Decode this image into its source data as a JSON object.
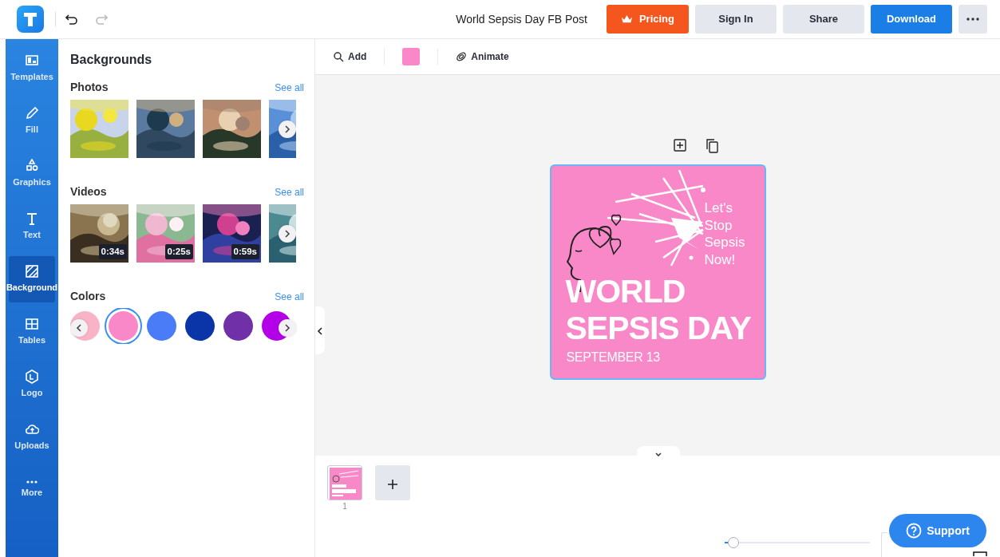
{
  "header": {
    "title": "World Sepsis Day FB Post",
    "buttons": [
      {
        "label": "Pricing",
        "kind": "pricing"
      },
      {
        "label": "Sign In",
        "kind": "secondary"
      },
      {
        "label": "Share",
        "kind": "secondary"
      },
      {
        "label": "Download",
        "kind": "primary"
      }
    ]
  },
  "sidebar": {
    "items": [
      {
        "label": "Templates",
        "kind": "templates",
        "selected": false
      },
      {
        "label": "Fill",
        "kind": "fill",
        "selected": false
      },
      {
        "label": "Graphics",
        "kind": "graphics",
        "selected": false
      },
      {
        "label": "Text",
        "kind": "text",
        "selected": false
      },
      {
        "label": "Background",
        "kind": "background",
        "selected": true
      },
      {
        "label": "Tables",
        "kind": "tables",
        "selected": false
      },
      {
        "label": "Logo",
        "kind": "logo",
        "selected": false
      },
      {
        "label": "Uploads",
        "kind": "uploads",
        "selected": false
      },
      {
        "label": "More",
        "kind": "more",
        "selected": false
      }
    ]
  },
  "panel": {
    "title": "Backgrounds",
    "sections": [
      {
        "title": "Photos",
        "link": "See all",
        "kind": "media",
        "items": [
          {
            "kind": "picture"
          },
          {
            "kind": "picture"
          },
          {
            "kind": "picture"
          },
          {
            "kind": "picture"
          }
        ]
      },
      {
        "title": "Videos",
        "link": "See all",
        "kind": "media",
        "items": [
          {
            "kind": "picture",
            "duration": "0:34s"
          },
          {
            "kind": "picture",
            "duration": "0:25s"
          },
          {
            "kind": "picture",
            "duration": "0:59s"
          },
          {
            "kind": "picture"
          }
        ]
      },
      {
        "title": "Colors",
        "link": "See all",
        "kind": "colors",
        "items": [
          {
            "color": "#f8b4c6",
            "selected": false
          },
          {
            "color": "#f888c8",
            "selected": true
          },
          {
            "color": "#4a7cf7",
            "selected": false
          },
          {
            "color": "#0a35a8",
            "selected": false
          },
          {
            "color": "#7030a8",
            "selected": false
          },
          {
            "color": "#b400e6",
            "selected": false
          }
        ]
      }
    ]
  },
  "toolbar": {
    "add": "Add",
    "fill": {
      "color": "#f888c8"
    },
    "animate": "Animate"
  },
  "design": {
    "color": "#f888c8",
    "tagline": "Let's Stop Sepsis Now!",
    "headline": "WORLD SEPSIS DAY",
    "date": "SEPTEMBER 13"
  },
  "pages": [
    {
      "number": "1",
      "selected": true
    }
  ],
  "zoom": {
    "level": 0.06
  },
  "support": {
    "label": "Support"
  }
}
